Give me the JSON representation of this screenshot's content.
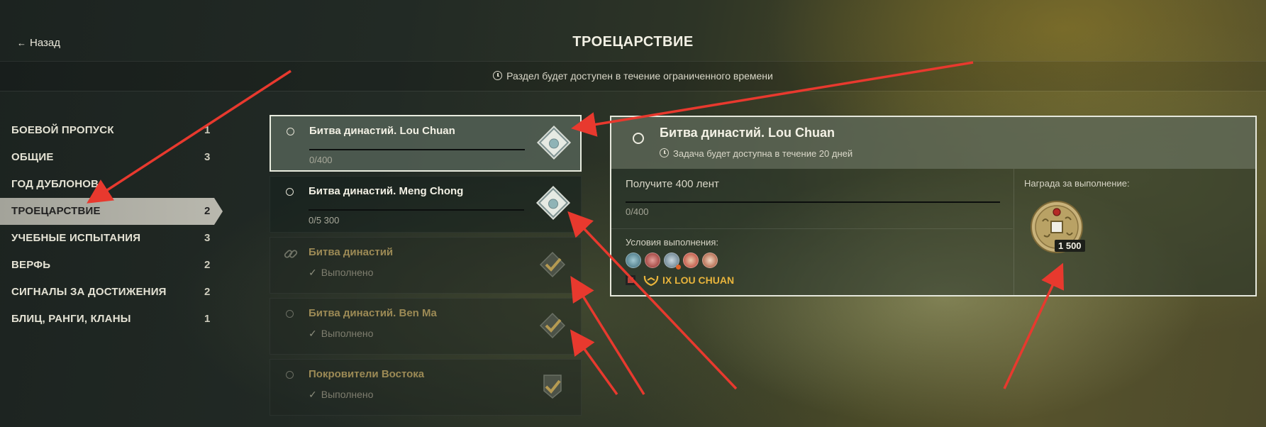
{
  "header": {
    "back_label": "Назад",
    "title": "ТРОЕЦАРСТВИЕ",
    "notice": "Раздел будет доступен в течение ограниченного времени"
  },
  "sidebar": {
    "items": [
      {
        "label": "БОЕВОЙ ПРОПУСК",
        "count": "1",
        "active": false
      },
      {
        "label": "ОБЩИЕ",
        "count": "3",
        "active": false
      },
      {
        "label": "ГОД ДУБЛОНОВ",
        "count": "",
        "active": false
      },
      {
        "label": "ТРОЕЦАРСТВИЕ",
        "count": "2",
        "active": true
      },
      {
        "label": "УЧЕБНЫЕ ИСПЫТАНИЯ",
        "count": "3",
        "active": false
      },
      {
        "label": "ВЕРФЬ",
        "count": "2",
        "active": false
      },
      {
        "label": "СИГНАЛЫ ЗА ДОСТИЖЕНИЯ",
        "count": "2",
        "active": false
      },
      {
        "label": "БЛИЦ, РАНГИ, КЛАНЫ",
        "count": "1",
        "active": false
      }
    ]
  },
  "tasks": [
    {
      "name": "Битва династий. Lou Chuan",
      "progress": "0/400",
      "state": "selected"
    },
    {
      "name": "Битва династий. Meng Chong",
      "progress": "0/5 300",
      "state": "active"
    },
    {
      "name": "Битва династий",
      "status": "Выполнено",
      "state": "done"
    },
    {
      "name": "Битва династий. Ben Ma",
      "status": "Выполнено",
      "state": "done"
    },
    {
      "name": "Покровители Востока",
      "status": "Выполнено",
      "state": "done"
    }
  ],
  "detail": {
    "title": "Битва династий. Lou Chuan",
    "availability": "Задача будет доступна в течение 20 дней",
    "goal": "Получите 400 лент",
    "progress": "0/400",
    "conditions_label": "Условия выполнения:",
    "ship": "IX LOU CHUAN",
    "reward_label": "Награда за выполнение:",
    "reward_amount": "1 500"
  },
  "colors": {
    "accent_gold": "#e8b43c",
    "done_text": "#9c8a55",
    "annotation_red": "#e8392e"
  }
}
